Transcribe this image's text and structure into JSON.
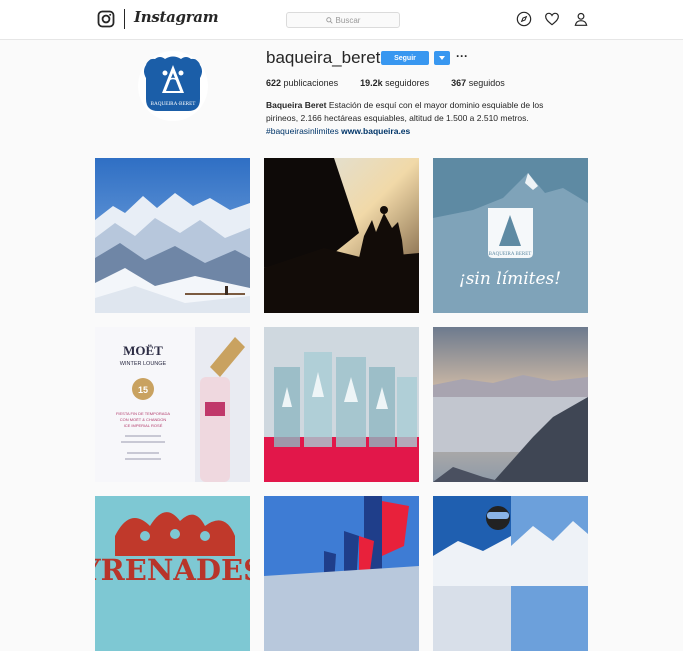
{
  "header": {
    "brand": "Instagram",
    "search_placeholder": "Buscar"
  },
  "profile": {
    "username": "baqueira_beret",
    "follow_label": "Seguir",
    "stats": [
      {
        "value": "622",
        "label": "publicaciones"
      },
      {
        "value": "19.2k",
        "label": "seguidores"
      },
      {
        "value": "367",
        "label": "seguidos"
      }
    ],
    "bio_name": "Baqueira Beret",
    "bio_text": "Estación de esquí con el mayor dominio esquiable de los pirineos, 2.166 hectáreas esquiables, altitud de 1.500 a 2.510 metros.",
    "bio_hashtag": "#baqueirasinlimites",
    "bio_link": "www.baqueira.es",
    "logo_text": "BAQUEIRA·BERET"
  },
  "posts": [
    {
      "id": "mountains-snow"
    },
    {
      "id": "silhouette-sunset"
    },
    {
      "id": "sin-limites-poster",
      "text": "¡sin límites!",
      "logo_text": "BAQUEIRA BERET"
    },
    {
      "id": "moet-winter-lounge",
      "title": "MOËT",
      "subtitle": "WINTER LOUNGE",
      "date": "15",
      "lines": [
        "FIESTA FIN DE TEMPORADA",
        "CON MOËT & CHANDON",
        "ICE IMPERIAL ROSÉ"
      ]
    },
    {
      "id": "trophies"
    },
    {
      "id": "sea-of-clouds"
    },
    {
      "id": "pyrenades",
      "text": "YRENADES"
    },
    {
      "id": "flags-sky"
    },
    {
      "id": "skier-collage"
    }
  ],
  "colors": {
    "accent": "#3897f0",
    "brand_blue": "#1b5ea8",
    "link": "#003569"
  }
}
